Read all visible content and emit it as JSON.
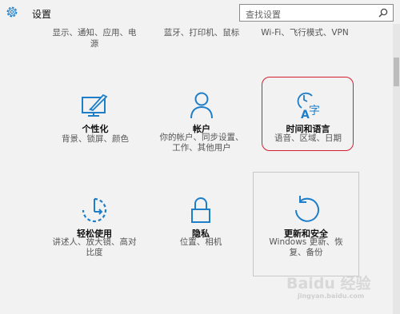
{
  "header": {
    "title": "设置",
    "search_placeholder": "查找设置"
  },
  "top_row": [
    {
      "label_line1": "显示、通知、应用、电",
      "label_line2": "源"
    },
    {
      "label_line1": "蓝牙、打印机、鼠标",
      "label_line2": ""
    },
    {
      "label_line1": "Wi-Fi、飞行模式、VPN",
      "label_line2": ""
    }
  ],
  "tiles": {
    "personalization": {
      "title": "个性化",
      "desc1": "背景、锁屏、颜色",
      "desc2": "",
      "icon": "personalization-icon"
    },
    "accounts": {
      "title": "帐户",
      "desc1": "你的帐户、同步设置、",
      "desc2": "工作、其他用户",
      "icon": "person-icon"
    },
    "time_language": {
      "title": "时间和语言",
      "desc1": "语音、区域、日期",
      "desc2": "",
      "icon": "time-language-icon"
    },
    "ease_of_access": {
      "title": "轻松使用",
      "desc1": "讲述人、放大镜、高对",
      "desc2": "比度",
      "icon": "ease-of-access-icon"
    },
    "privacy": {
      "title": "隐私",
      "desc1": "位置、相机",
      "desc2": "",
      "icon": "lock-icon"
    },
    "update_security": {
      "title": "更新和安全",
      "desc1": "Windows 更新、恢",
      "desc2": "复、备份",
      "icon": "refresh-icon"
    }
  },
  "watermark": {
    "main": "Baidu 经验",
    "sub": "jingyan.baidu.com"
  },
  "colors": {
    "accent": "#1e7ec8",
    "highlight": "#d31f2f",
    "background": "#f2f2f2"
  }
}
